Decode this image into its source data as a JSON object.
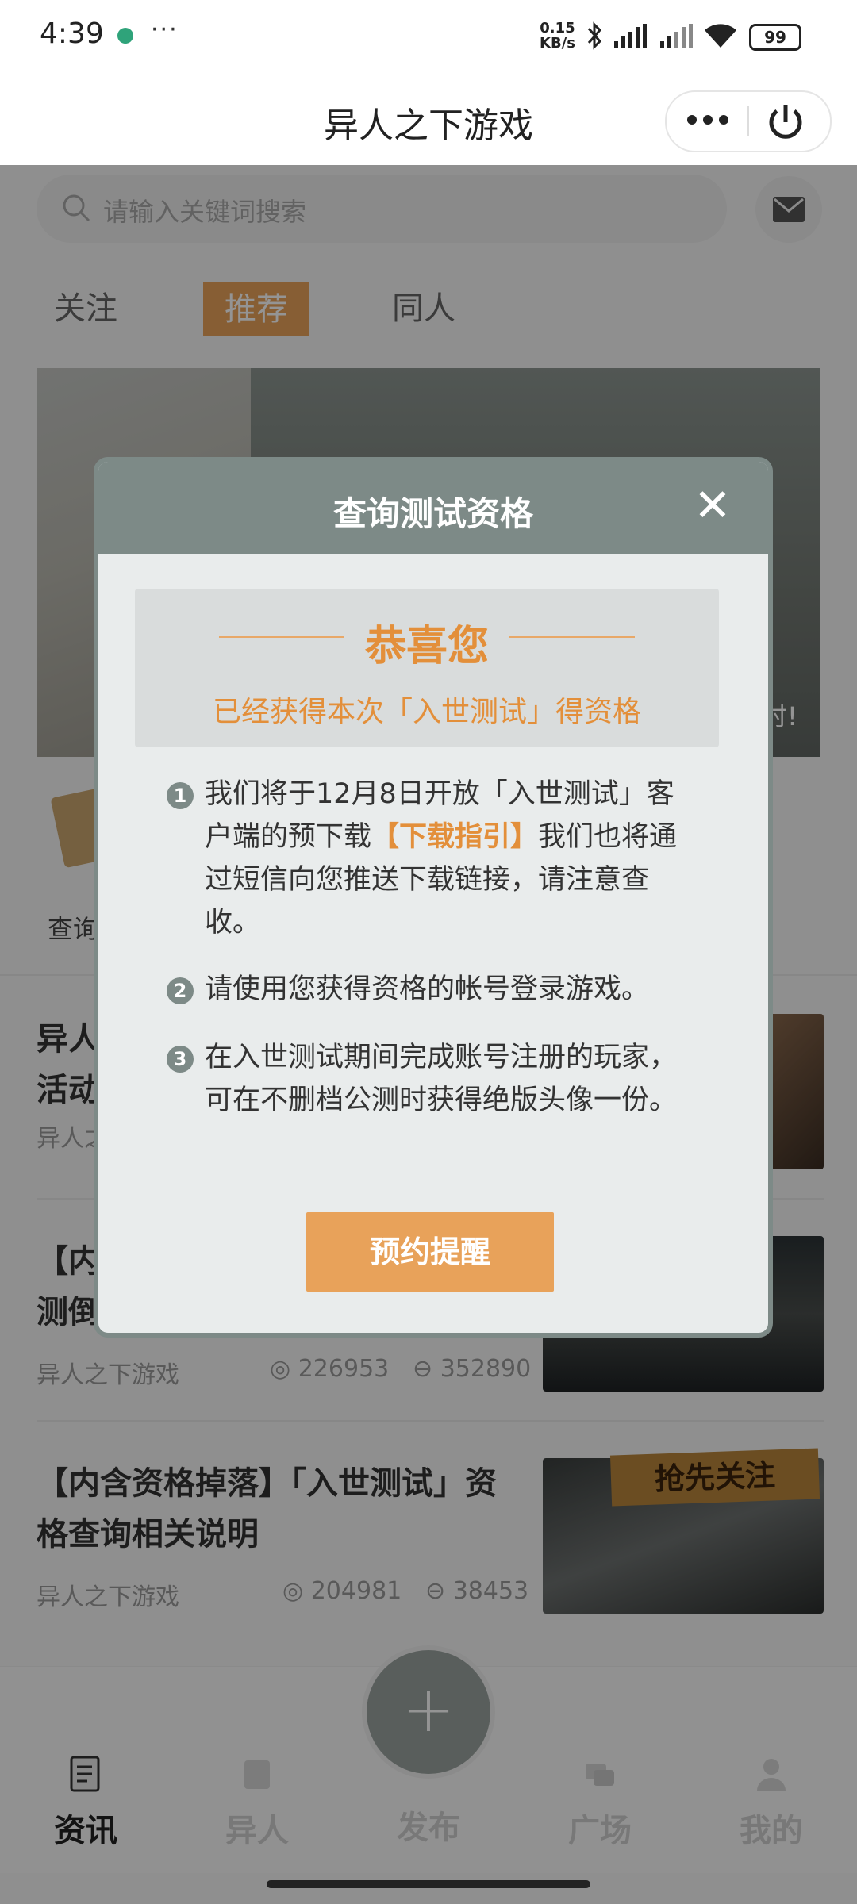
{
  "status_bar": {
    "time": "4:39",
    "more": "···",
    "net_speed_value": "0.15",
    "net_speed_unit": "KB/s",
    "battery": "99"
  },
  "nav": {
    "title": "异人之下游戏"
  },
  "search": {
    "placeholder": "请输入关键词搜索"
  },
  "tabs": [
    "关注",
    "推荐",
    "同人"
  ],
  "active_tab": "推荐",
  "shortcut_label": "查询",
  "articles": [
    {
      "title_line1": "异人",
      "title_line2": "活动",
      "source": "异人之",
      "views": "",
      "comments": ""
    },
    {
      "title_line1": "【内",
      "title_line2": "测倒",
      "source": "异人之下游戏",
      "views": "226953",
      "comments": "352890"
    },
    {
      "title_line1": "【内含资格掉落】「入世测试」资",
      "title_line2": "格查询相关说明",
      "source": "异人之下游戏",
      "views": "204981",
      "comments": "38453"
    }
  ],
  "banner_tail": "时!",
  "follow_badge": "抢先关注",
  "tabbar": {
    "items": [
      "资讯",
      "异人",
      "发布",
      "广场",
      "我的"
    ],
    "active": "资讯"
  },
  "modal": {
    "title": "查询测试资格",
    "close": "✕",
    "congrats_title": "恭喜您",
    "congrats_sub": "已经获得本次「入世测试」得资格",
    "items": [
      {
        "num": "1",
        "text_before": "我们将于12月8日开放「入世测试」客户端的预下载",
        "highlight": "【下载指引】",
        "text_after": "我们也将通过短信向您推送下载链接，请注意查收。"
      },
      {
        "num": "2",
        "text_before": "请使用您获得资格的帐号登录游戏。",
        "highlight": "",
        "text_after": ""
      },
      {
        "num": "3",
        "text_before": "在入世测试期间完成账号注册的玩家，可在不删档公测时获得绝版头像一份。",
        "highlight": "",
        "text_after": ""
      }
    ],
    "reserve_button": "预约提醒"
  },
  "colors": {
    "accent": "#e8a25a",
    "modal_header": "#7d8a87",
    "highlight_text": "#e38f3a"
  }
}
